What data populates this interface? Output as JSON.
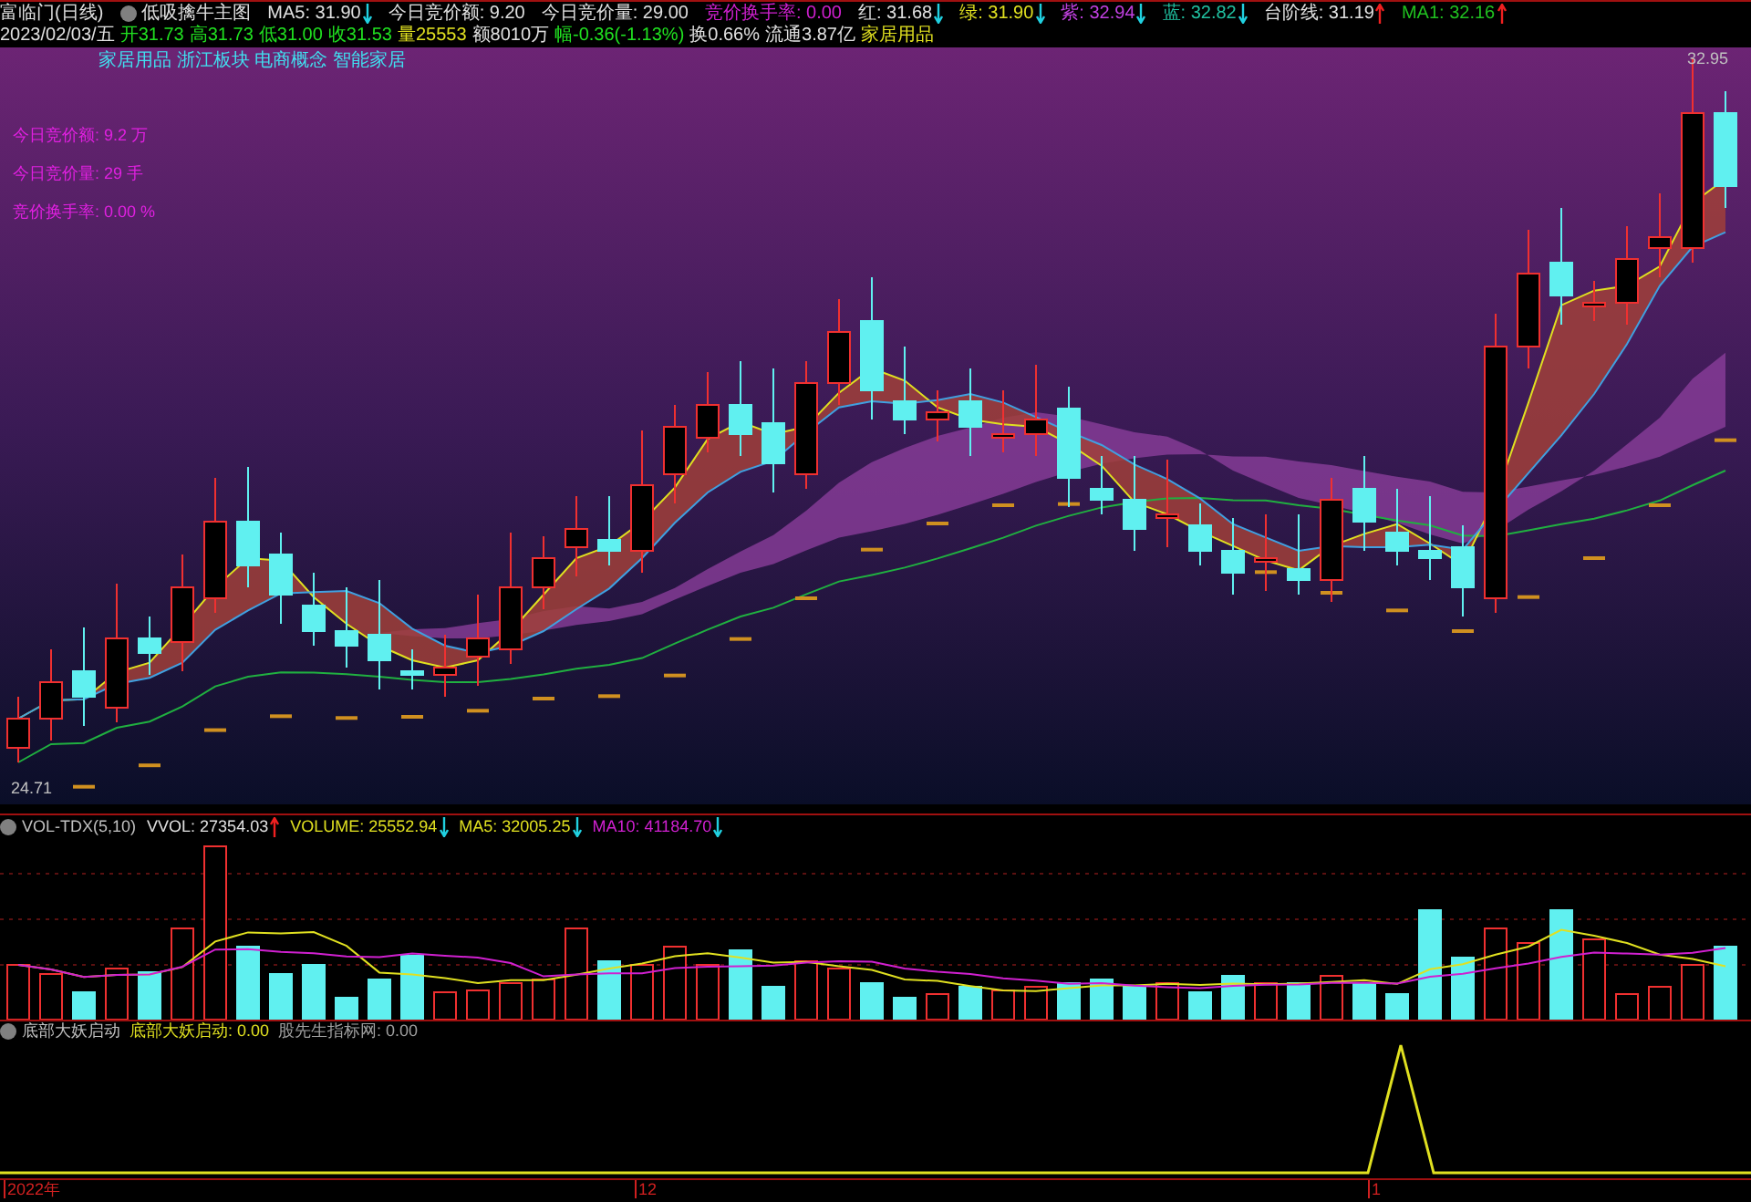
{
  "header": {
    "stock_name": "富临门(日线)",
    "formula": "低吸擒牛主图",
    "readings": [
      {
        "text": "MA5: 31.90",
        "rising": false,
        "color": "#e0e0e0"
      },
      {
        "text": "今日竞价额: 9.20",
        "color": "#e0e0e0"
      },
      {
        "text": "今日竞价量: 29.00",
        "color": "#e0e0e0"
      },
      {
        "text": "竞价换手率: 0.00",
        "color": "#d020d0"
      },
      {
        "text": "红: 31.68",
        "rising": false,
        "color": "#e0e0e0"
      },
      {
        "text": "绿: 31.90",
        "rising": false,
        "color": "#e0e020"
      },
      {
        "text": "紫: 32.94",
        "rising": false,
        "color": "#c040e0"
      },
      {
        "text": "蓝: 32.82",
        "rising": false,
        "color": "#20c0a0"
      },
      {
        "text": "台阶线: 31.19",
        "rising": true,
        "color": "#e0e0e0"
      },
      {
        "text": "MA1: 32.16",
        "rising": true,
        "color": "#20c020"
      }
    ],
    "quote": [
      {
        "text": "2023/02/03/五",
        "color": "#e0e0e0"
      },
      {
        "text": "开31.73",
        "color": "#20e020"
      },
      {
        "text": "高31.73",
        "color": "#20e020"
      },
      {
        "text": "低31.00",
        "color": "#20e020"
      },
      {
        "text": "收31.53",
        "color": "#20e020"
      },
      {
        "text": "量25553",
        "color": "#e0e020"
      },
      {
        "text": "额8010万",
        "color": "#e0e0e0"
      },
      {
        "text": "幅-0.36(-1.13%)",
        "color": "#20e020"
      },
      {
        "text": "换0.66%",
        "color": "#e0e0e0"
      },
      {
        "text": "流通3.87亿",
        "color": "#e0e0e0"
      },
      {
        "text": "家居用品",
        "color": "#e0e020"
      }
    ]
  },
  "main_chart": {
    "concepts": "家居用品 浙江板块 电商概念 智能家居",
    "auction_lines": [
      "今日竞价额: 9.2 万",
      "今日竞价量: 29 手",
      "竞价换手率: 0.00 %"
    ],
    "low_label": "24.71",
    "high_label": "32.95"
  },
  "volume_panel": {
    "name": "VOL-TDX(5,10)",
    "readings": [
      {
        "text": "VVOL: 27354.03",
        "rising": true,
        "color": "#e0e0e0"
      },
      {
        "text": "VOLUME: 25552.94",
        "rising": false,
        "color": "#e0e020"
      },
      {
        "text": "MA5: 32005.25",
        "rising": false,
        "color": "#e0e020"
      },
      {
        "text": "MA10: 41184.70",
        "rising": false,
        "color": "#d020d0"
      }
    ]
  },
  "indicator_panel": {
    "name": "底部大妖启动",
    "readings": [
      {
        "text": "底部大妖启动: 0.00",
        "color": "#e0e020"
      },
      {
        "text": "股先生指标网: 0.00",
        "color": "#a0a0a0"
      }
    ]
  },
  "time_axis": [
    "2022年",
    "12",
    "1"
  ]
}
